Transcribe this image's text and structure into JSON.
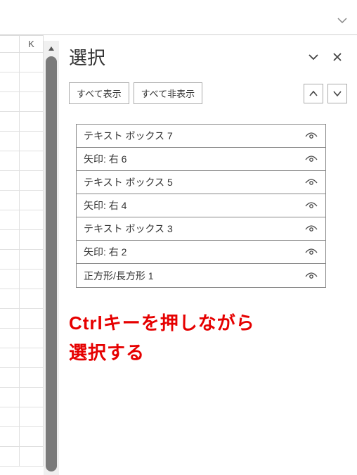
{
  "column_label": "K",
  "pane": {
    "title": "選択",
    "show_all": "すべて表示",
    "hide_all": "すべて非表示"
  },
  "objects": [
    {
      "label": "テキスト ボックス 7"
    },
    {
      "label": "矢印: 右 6"
    },
    {
      "label": "テキスト ボックス 5"
    },
    {
      "label": "矢印: 右 4"
    },
    {
      "label": "テキスト ボックス 3"
    },
    {
      "label": "矢印: 右 2"
    },
    {
      "label": "正方形/長方形 1"
    }
  ],
  "annotation": {
    "line1": "Ctrlキーを押しながら",
    "line2": "選択する"
  }
}
